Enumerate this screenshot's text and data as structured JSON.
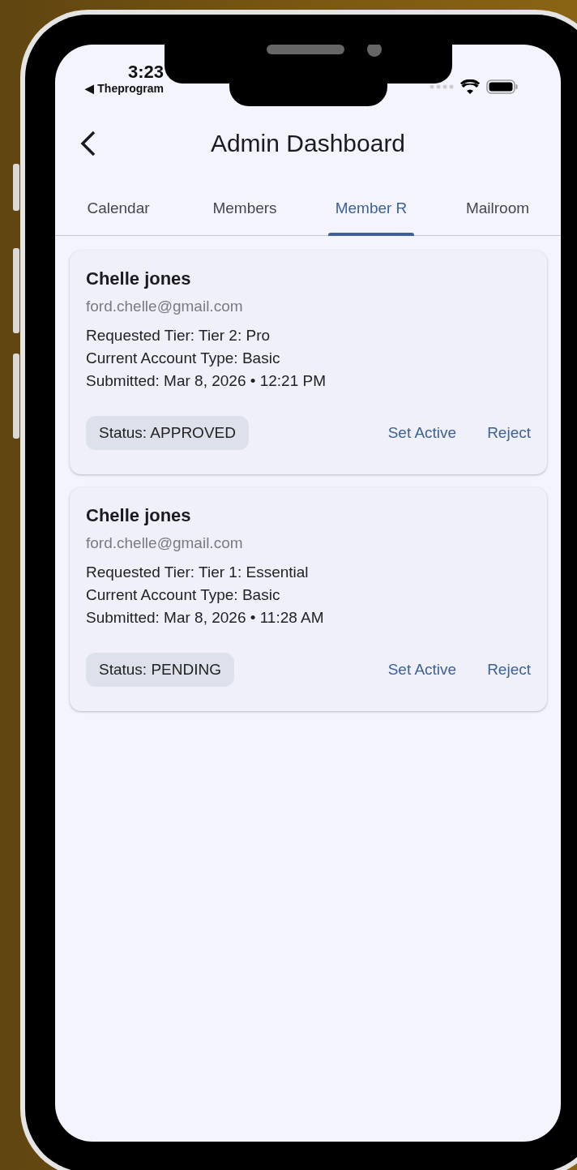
{
  "status_bar": {
    "time": "3:23",
    "back_app": "◀ Theprogram"
  },
  "header": {
    "title": "Admin Dashboard"
  },
  "tabs": [
    {
      "label": "Calendar",
      "selected": false
    },
    {
      "label": "Members",
      "selected": false
    },
    {
      "label": "Member R",
      "selected": true
    },
    {
      "label": "Mailroom",
      "selected": false
    }
  ],
  "requests": [
    {
      "name": "Chelle jones",
      "email": "ford.chelle@gmail.com",
      "requested_tier": "Requested Tier: Tier 2: Pro",
      "current_type": "Current Account Type: Basic",
      "submitted": "Submitted: Mar 8, 2026 • 12:21 PM",
      "status": "Status: APPROVED",
      "actions": [
        "Set Active",
        "Reject"
      ]
    },
    {
      "name": "Chelle jones",
      "email": "ford.chelle@gmail.com",
      "requested_tier": "Requested Tier: Tier 1: Essential",
      "current_type": "Current Account Type: Basic",
      "submitted": "Submitted: Mar 8, 2026 • 11:28 AM",
      "status": "Status: PENDING",
      "actions": [
        "Set Active",
        "Reject"
      ]
    }
  ]
}
